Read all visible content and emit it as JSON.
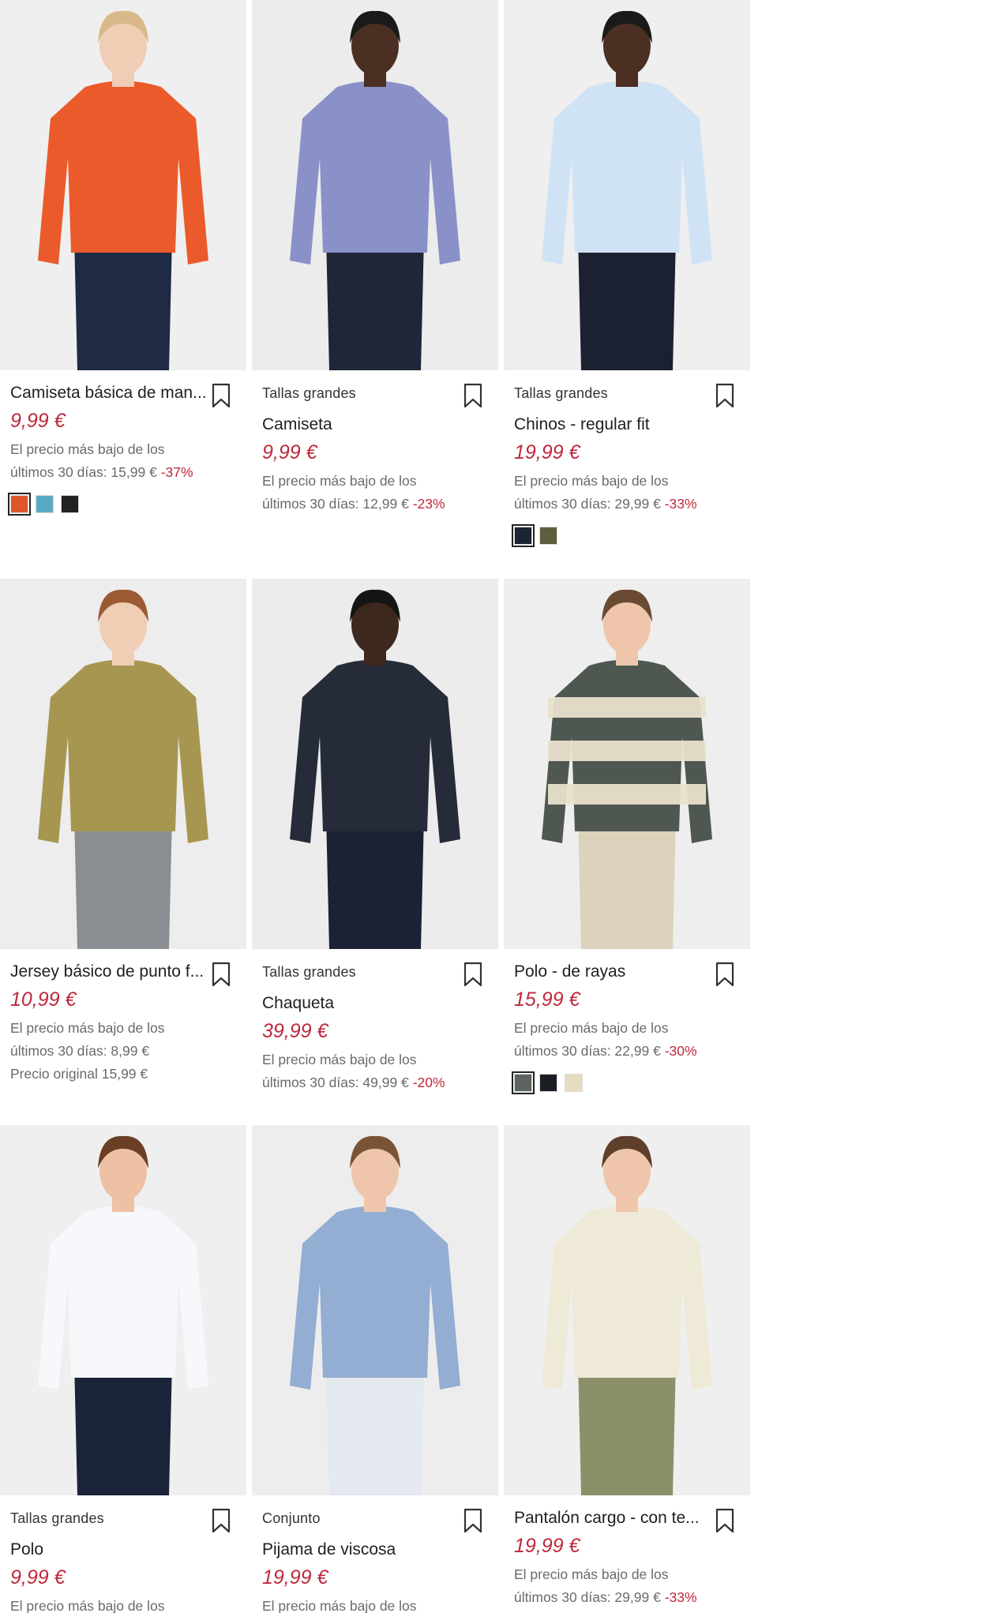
{
  "products": [
    {
      "tag": "",
      "title": "Camiseta básica de man...",
      "price": "9,99 €",
      "note_line1": "El precio más bajo de los",
      "note_line2": "últimos 30 días: 15,99 €",
      "discount": "-37%",
      "note_line3": "",
      "swatches": [
        "#e0542b",
        "#5aa9c2",
        "#222222"
      ],
      "photo": {
        "bg": "#efefef",
        "top": "#ea5a2a",
        "bottom": "#1f2a44",
        "skin": "#f0cdb5",
        "hair": "#d9b98a"
      }
    },
    {
      "tag": "Tallas grandes",
      "title": "Camiseta",
      "price": "9,99 €",
      "note_line1": "El precio más bajo de los",
      "note_line2": "últimos 30 días: 12,99 €",
      "discount": "-23%",
      "note_line3": "",
      "swatches": [],
      "photo": {
        "bg": "#ececec",
        "top": "#8a90c8",
        "bottom": "#1e2637",
        "skin": "#4a2f22",
        "hair": "#1a1a1a"
      }
    },
    {
      "tag": "Tallas grandes",
      "title": "Chinos - regular fit",
      "price": "19,99 €",
      "note_line1": "El precio más bajo de los",
      "note_line2": "últimos 30 días: 29,99 €",
      "discount": "-33%",
      "note_line3": "",
      "swatches": [
        "#1c2436",
        "#5d5e3e"
      ],
      "photo": {
        "bg": "#efefef",
        "top": "#cfe3f5",
        "bottom": "#1b2130",
        "skin": "#4a2f22",
        "hair": "#1a1a1a"
      }
    },
    {
      "tag": "",
      "title": "Jersey básico de punto f...",
      "price": "10,99 €",
      "note_line1": "El precio más bajo de los",
      "note_line2": "últimos 30 días: 8,99 €",
      "discount": "",
      "note_line3": "Precio original 15,99 €",
      "swatches": [],
      "photo": {
        "bg": "#ededed",
        "top": "#a69650",
        "bottom": "#8a8e93",
        "skin": "#f0cdb5",
        "hair": "#9a5a34"
      }
    },
    {
      "tag": "Tallas grandes",
      "title": "Chaqueta",
      "price": "39,99 €",
      "note_line1": "El precio más bajo de los",
      "note_line2": "últimos 30 días: 49,99 €",
      "discount": "-20%",
      "note_line3": "",
      "swatches": [],
      "photo": {
        "bg": "#ececec",
        "top": "#262b3a",
        "bottom": "#1b2233",
        "skin": "#3d281d",
        "hair": "#151515"
      }
    },
    {
      "tag": "",
      "title": "Polo - de rayas",
      "price": "15,99 €",
      "note_line1": "El precio más bajo de los",
      "note_line2": "últimos 30 días: 22,99 €",
      "discount": "-30%",
      "note_line3": "",
      "swatches": [
        "#5c6460",
        "#1a1d24",
        "#e7dcc2"
      ],
      "photo": {
        "bg": "#eeeeee",
        "top": "#4f5751",
        "bottom": "#ddd2bb",
        "skin": "#efc6ab",
        "hair": "#6b4a34"
      }
    },
    {
      "tag": "Tallas grandes",
      "title": "Polo",
      "price": "9,99 €",
      "note_line1": "El precio más bajo de los",
      "note_line2": "",
      "discount": "",
      "note_line3": "",
      "swatches": [],
      "photo": {
        "bg": "#efefef",
        "top": "#f7f8fb",
        "bottom": "#1b2438",
        "skin": "#eec1a4",
        "hair": "#6a3f26"
      }
    },
    {
      "tag": "Conjunto",
      "title": "Pijama de viscosa",
      "price": "19,99 €",
      "note_line1": "El precio más bajo de los",
      "note_line2": "",
      "discount": "",
      "note_line3": "",
      "swatches": [],
      "photo": {
        "bg": "#ededed",
        "top": "#93add3",
        "bottom": "#e4e8ef",
        "skin": "#efc6ab",
        "hair": "#7a5436"
      }
    },
    {
      "tag": "",
      "title": "Pantalón cargo - con te...",
      "price": "19,99 €",
      "note_line1": "El precio más bajo de los",
      "note_line2": "últimos 30 días: 29,99 €",
      "discount": "-33%",
      "note_line3": "",
      "swatches": [],
      "photo": {
        "bg": "#efefef",
        "top": "#efe9d8",
        "bottom": "#8c9068",
        "skin": "#efc6ab",
        "hair": "#5e3f2a"
      }
    }
  ]
}
